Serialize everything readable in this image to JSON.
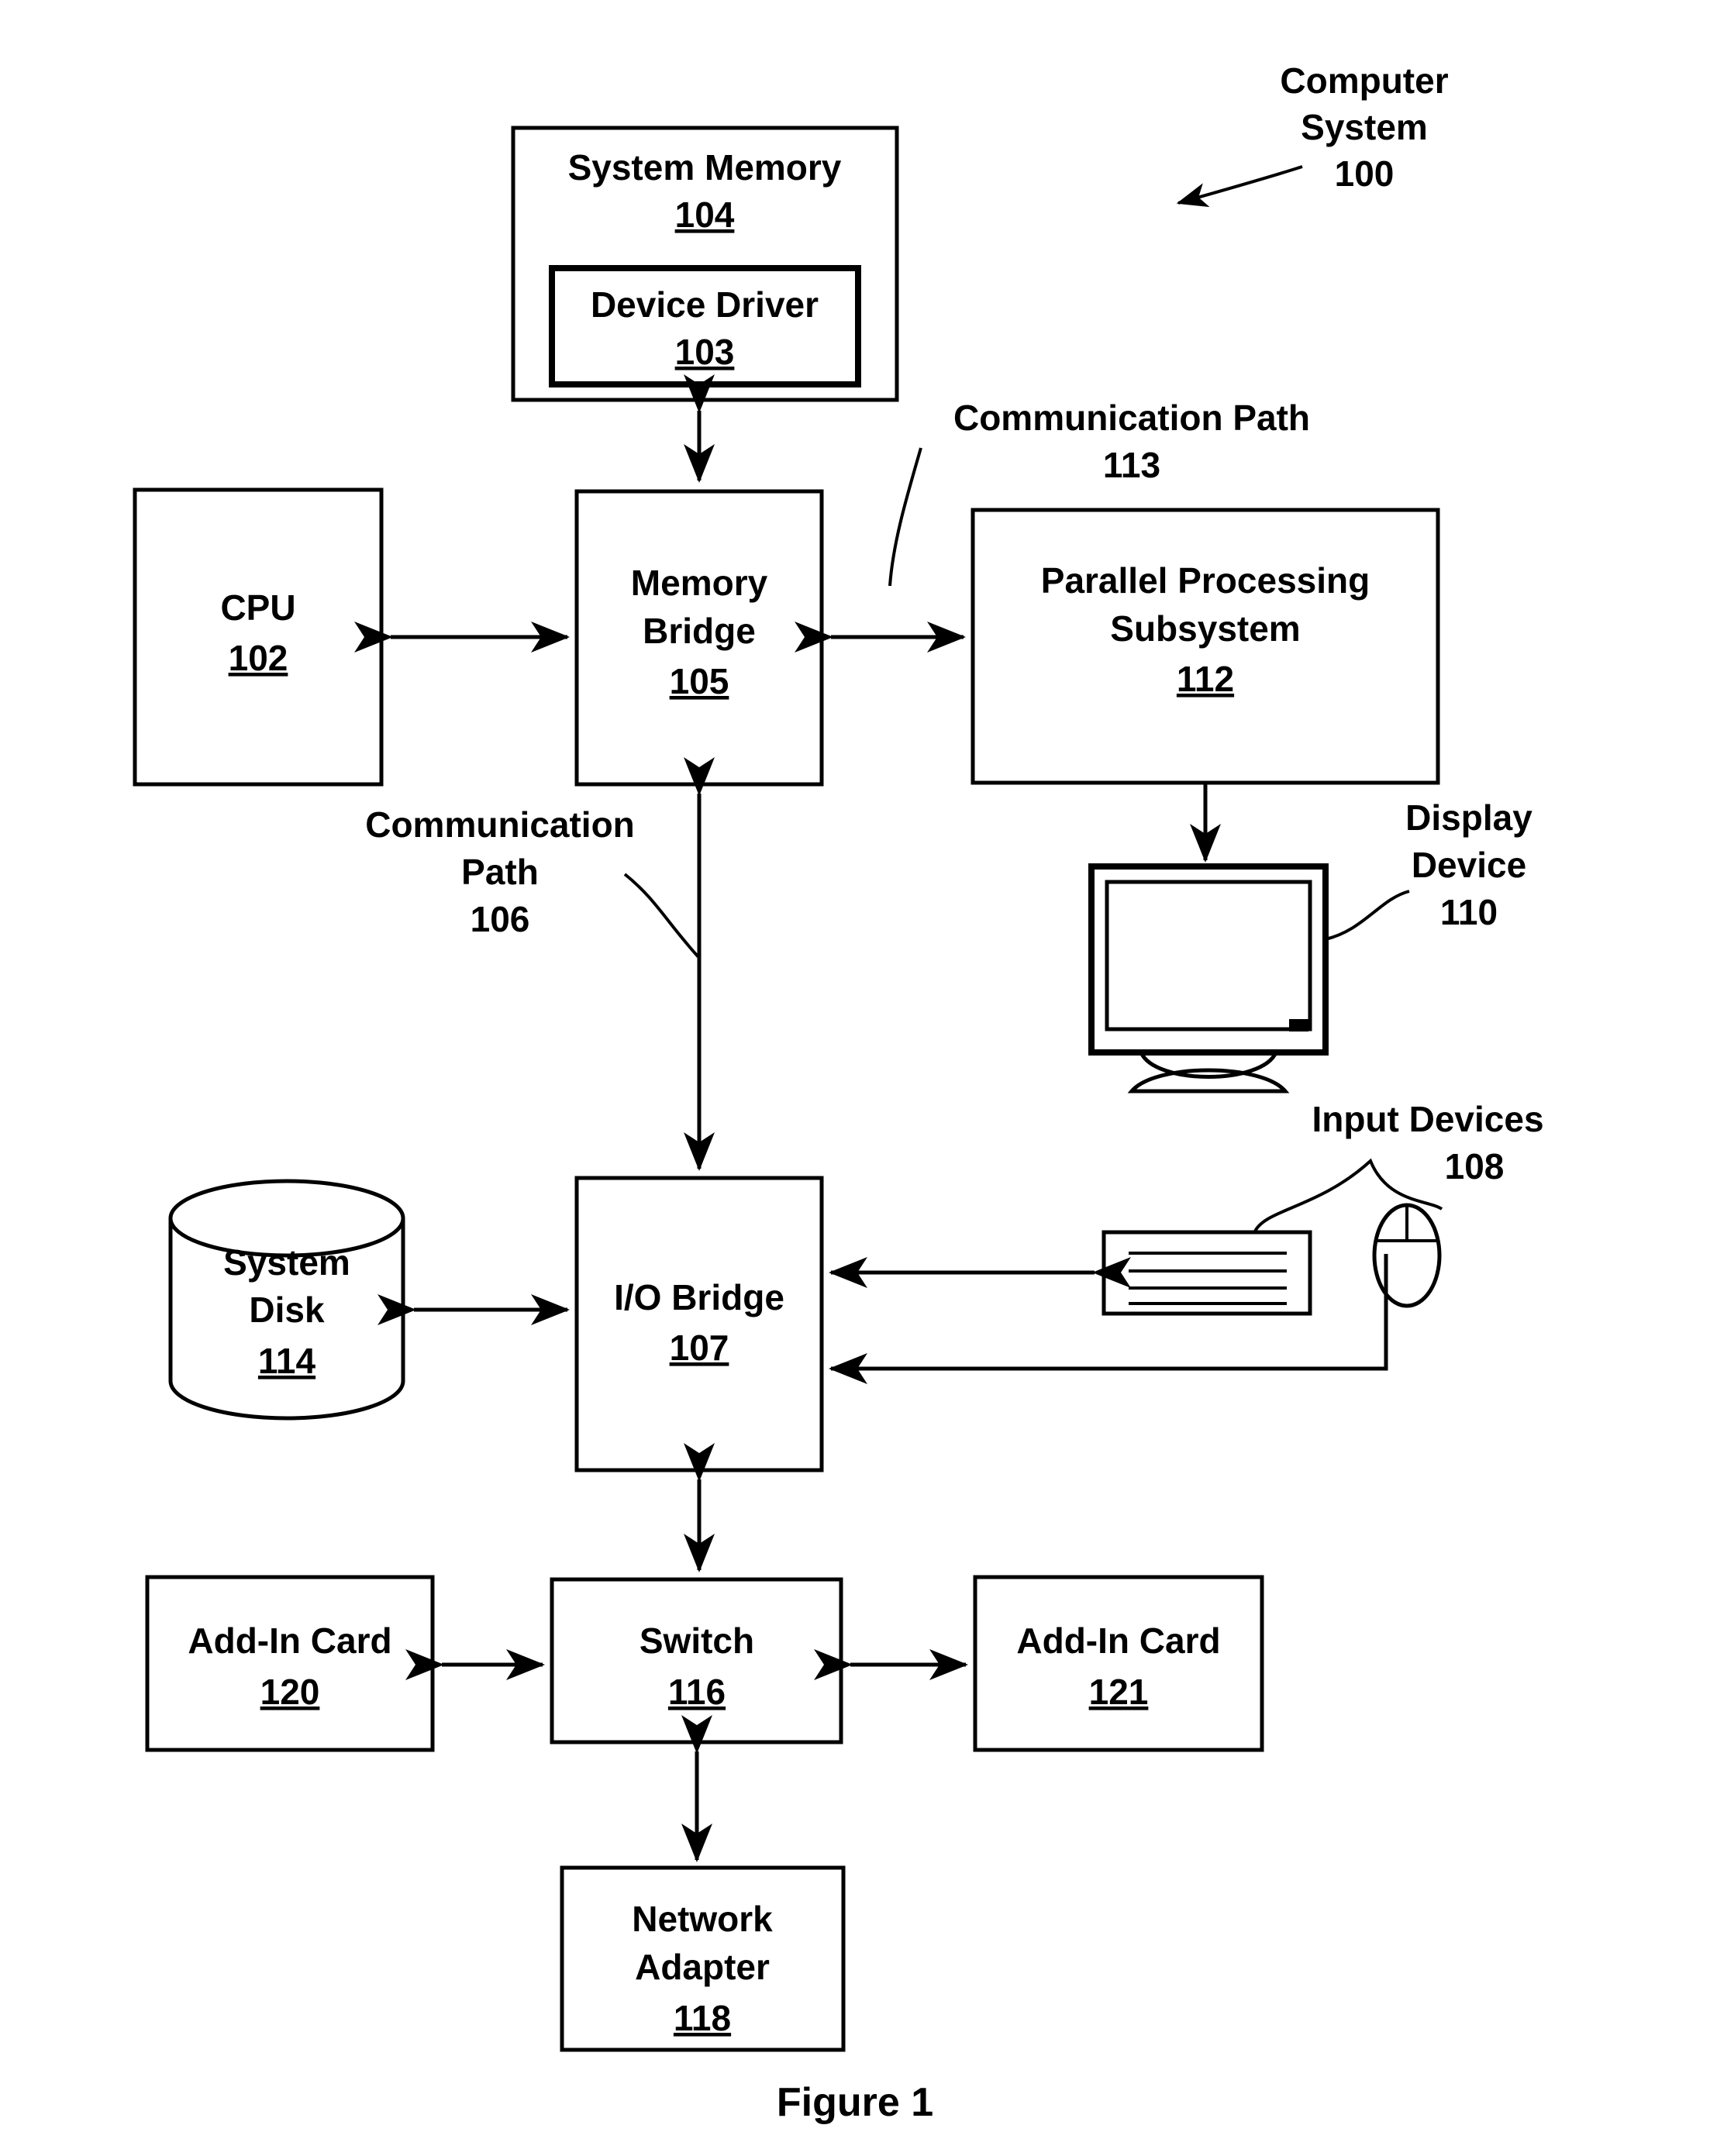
{
  "figure": {
    "caption": "Figure 1",
    "title_annotation": {
      "line1": "Computer",
      "line2": "System",
      "number": "100"
    }
  },
  "blocks": {
    "system_memory": {
      "label": "System Memory",
      "number": "104"
    },
    "device_driver": {
      "label": "Device Driver",
      "number": "103"
    },
    "cpu": {
      "label": "CPU",
      "number": "102"
    },
    "memory_bridge": {
      "label_line1": "Memory",
      "label_line2": "Bridge",
      "number": "105"
    },
    "parallel_processing_subsystem": {
      "label_line1": "Parallel Processing",
      "label_line2": "Subsystem",
      "number": "112"
    },
    "io_bridge": {
      "label": "I/O Bridge",
      "number": "107"
    },
    "system_disk": {
      "label_line1": "System",
      "label_line2": "Disk",
      "number": "114"
    },
    "switch": {
      "label": "Switch",
      "number": "116"
    },
    "add_in_card_left": {
      "label": "Add-In Card",
      "number": "120"
    },
    "add_in_card_right": {
      "label": "Add-In Card",
      "number": "121"
    },
    "network_adapter": {
      "label_line1": "Network",
      "label_line2": "Adapter",
      "number": "118"
    }
  },
  "annotations": {
    "communication_path_113": {
      "line1": "Communication Path",
      "number": "113"
    },
    "communication_path_106": {
      "line1": "Communication",
      "line2": "Path",
      "number": "106"
    },
    "display_device": {
      "line1": "Display",
      "line2": "Device",
      "number": "110"
    },
    "input_devices": {
      "line1": "Input Devices",
      "number": "108"
    }
  },
  "icons": {
    "display_device_icon": "monitor-icon",
    "keyboard_icon": "keyboard-icon",
    "mouse_icon": "mouse-icon",
    "system_disk_icon": "cylinder-database-icon"
  },
  "colors": {
    "stroke": "#000000",
    "fill": "#ffffff"
  }
}
